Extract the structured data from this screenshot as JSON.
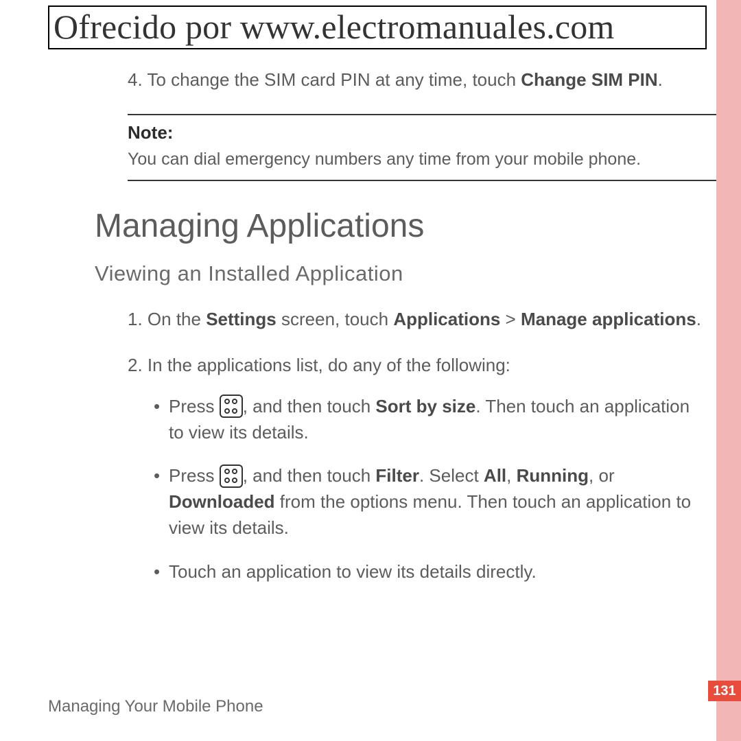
{
  "banner": "Ofrecido por www.electromanuales.com",
  "step4": {
    "num": "4.",
    "pre": " To change the SIM card PIN at any time, touch ",
    "bold": "Change SIM PIN",
    "post": "."
  },
  "note": {
    "label": "Note:",
    "text": "You can dial emergency numbers any time from your mobile phone."
  },
  "h1": "Managing Applications",
  "h2": "Viewing an Installed Application",
  "step1": {
    "num": "1.",
    "t1": " On the ",
    "b1": "Settings",
    "t2": " screen, touch ",
    "b2": "Applications",
    "t3": " > ",
    "b3": "Manage applications",
    "t4": "."
  },
  "step2": {
    "num": "2.",
    "text": " In the applications list, do any of the following:"
  },
  "bullets": {
    "b1": {
      "t1": "Press ",
      "t2": ", and then touch ",
      "bold1": "Sort by size",
      "t3": ". Then touch an application to view its details."
    },
    "b2": {
      "t1": "Press ",
      "t2": ", and then touch ",
      "bold1": "Filter",
      "t3": ". Select ",
      "bold2": "All",
      "t4": ", ",
      "bold3": "Running",
      "t5": ", or ",
      "bold4": "Downloaded",
      "t6": " from the options menu. Then touch an application to view its details."
    },
    "b3": {
      "t1": "Touch an application to view its details directly."
    }
  },
  "footer": "Managing Your Mobile Phone",
  "page_number": "131"
}
